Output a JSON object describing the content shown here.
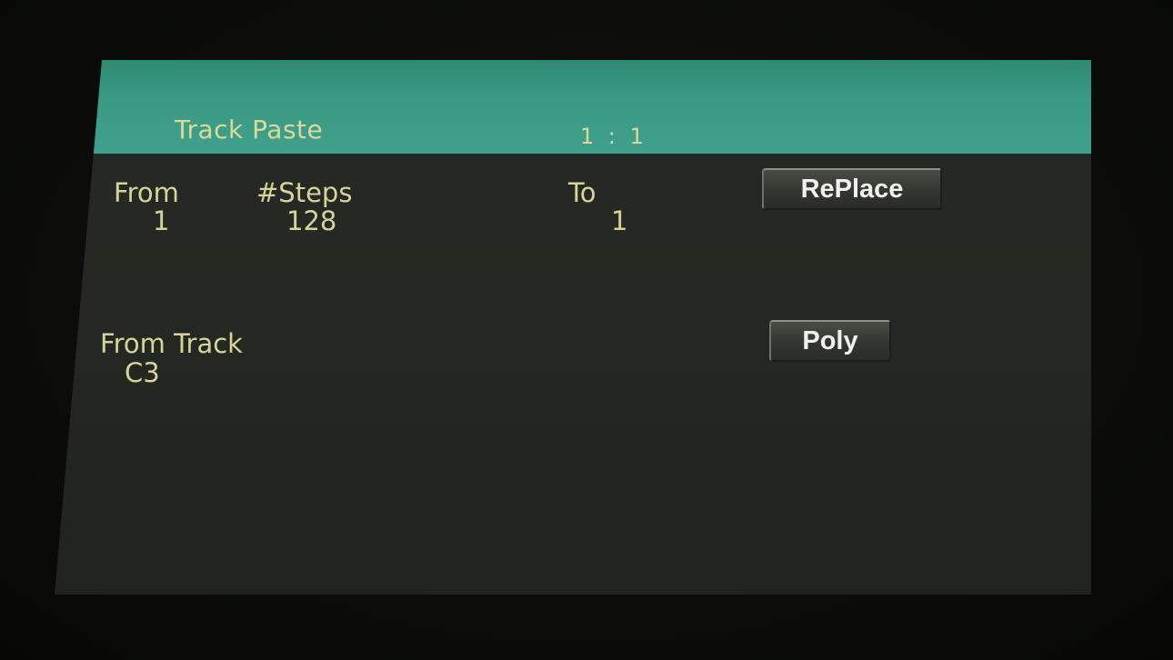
{
  "header": {
    "title": "Track Paste",
    "position": "1 : 1"
  },
  "params": {
    "from": {
      "label": "From",
      "value": "1"
    },
    "steps": {
      "label": "#Steps",
      "value": "128"
    },
    "to": {
      "label": "To",
      "value": "1"
    },
    "from_track": {
      "label": "From Track",
      "value": "C3"
    }
  },
  "buttons": {
    "replace": "RePlace",
    "poly": "Poly"
  },
  "colors": {
    "header_bg": "#3a9b84",
    "text": "#d6d49a",
    "screen_bg": "#252822"
  }
}
